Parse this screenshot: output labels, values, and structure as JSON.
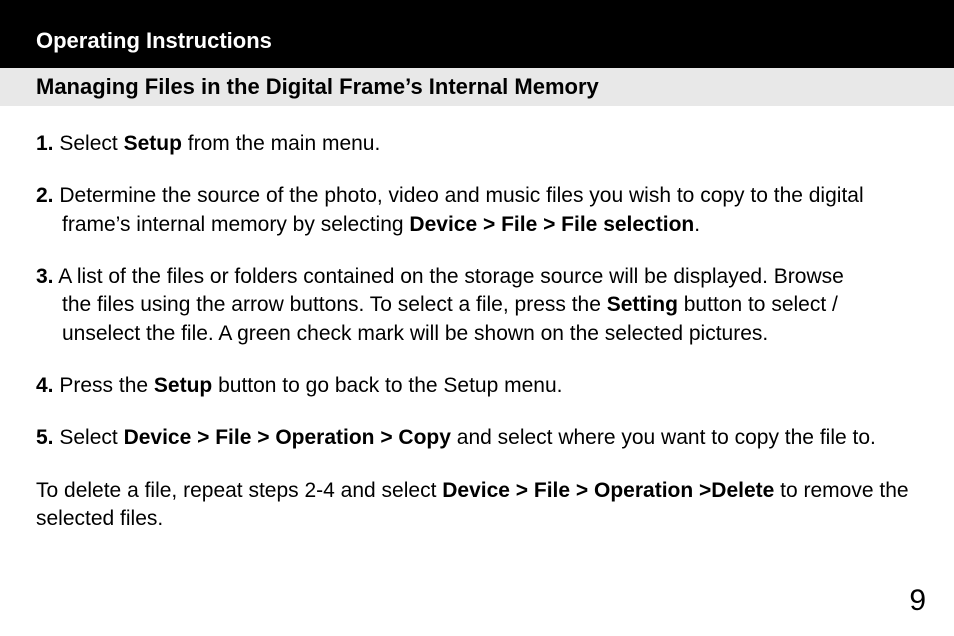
{
  "header": "Operating Instructions",
  "section": "Managing Files in the Digital Frame’s Internal Memory",
  "steps": {
    "s1_num": "1.",
    "s1_a": " Select ",
    "s1_b": "Setup",
    "s1_c": " from the main menu.",
    "s2_num": "2.",
    "s2_a": " Determine the source of the photo, video and music files you wish to copy to the digital",
    "s2_b": "frame’s internal memory by selecting ",
    "s2_b2": "Device > File > File selection",
    "s2_c": ".",
    "s3_num": "3.",
    "s3_a": " A list of the files or folders contained on the storage source will be displayed. Browse",
    "s3_b": "the files using the arrow buttons. To select a file, press the ",
    "s3_b2": "Setting",
    "s3_b3": " button to select / ",
    "s3_c": "unselect the file.  A green check mark will be shown on the selected pictures.",
    "s4_num": "4.",
    "s4_a": " Press the ",
    "s4_b": "Setup",
    "s4_c": " button to go back to the Setup menu.",
    "s5_num": "5.",
    "s5_a": " Select ",
    "s5_b": "Device > File > Operation > Copy",
    "s5_c": " and select where you want to copy the file to."
  },
  "delete_a": "To delete a file, repeat steps 2-4 and select ",
  "delete_b": "Device > File > Operation >Delete",
  "delete_c": " to remove the selected files.",
  "page_number": "9"
}
